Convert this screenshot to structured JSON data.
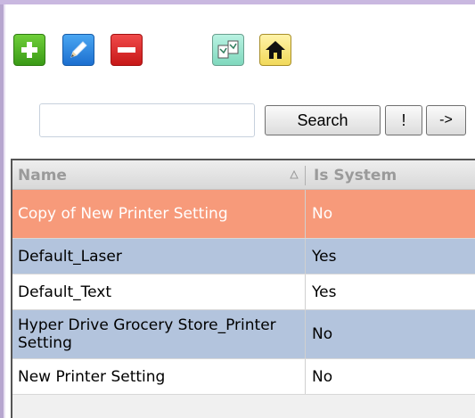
{
  "toolbar": {
    "add": {
      "icon": "plus-icon",
      "color": "#3a9a16"
    },
    "edit": {
      "icon": "pencil-icon",
      "color": "#1c6fd0"
    },
    "delete": {
      "icon": "minus-icon",
      "color": "#c71818"
    },
    "copy": {
      "icon": "copy-documents-icon",
      "color": "#7fd8bd"
    },
    "home": {
      "icon": "home-icon",
      "color": "#f1d95a"
    }
  },
  "search": {
    "value": "",
    "placeholder": "",
    "button_label": "Search",
    "bang_label": "!",
    "go_label": "->"
  },
  "grid": {
    "columns": [
      "Name",
      "Is System"
    ],
    "sort": {
      "column": "Name",
      "direction": "ascending"
    },
    "rows": [
      {
        "name": "Copy of New Printer Setting",
        "is_system": "No",
        "selected": true
      },
      {
        "name": "Default_Laser",
        "is_system": "Yes",
        "selected": false
      },
      {
        "name": "Default_Text",
        "is_system": "Yes",
        "selected": false
      },
      {
        "name": "Hyper Drive Grocery Store_Printer Setting",
        "is_system": "No",
        "selected": false
      },
      {
        "name": "New Printer Setting",
        "is_system": "No",
        "selected": false
      }
    ]
  },
  "colors": {
    "selected_row": "#f79a7a",
    "alt_row": "#b3c4dd",
    "plain_row": "#ffffff",
    "header_text": "#9a9a9a"
  }
}
